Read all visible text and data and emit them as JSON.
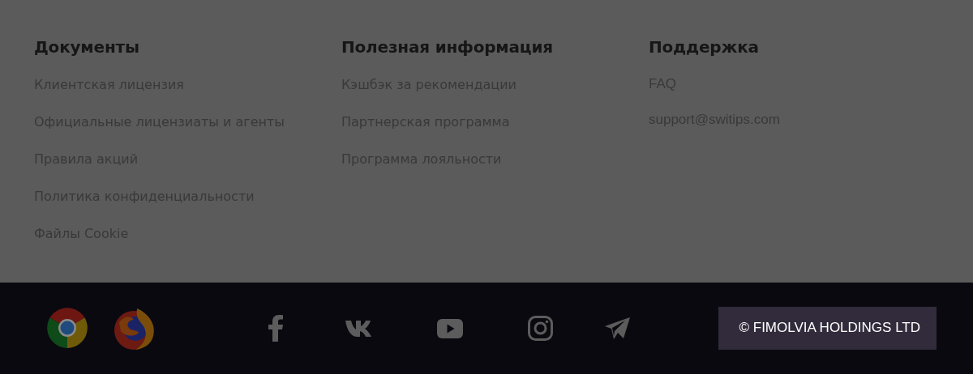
{
  "columns": [
    {
      "title": "Документы",
      "links": [
        "Клиентская лицензия",
        "Официальные лицензиаты и агенты",
        "Правила акций",
        "Политика конфиденциальности",
        "Файлы Cookie"
      ]
    },
    {
      "title": "Полезная информация",
      "links": [
        "Кэшбэк за рекомендации",
        "Партнерская программа",
        "Программа лояльности"
      ]
    },
    {
      "title": "Поддержка",
      "links": [
        "FAQ",
        "support@switips.com"
      ]
    }
  ],
  "copyright": "© FIMOLVIA HOLDINGS LTD"
}
